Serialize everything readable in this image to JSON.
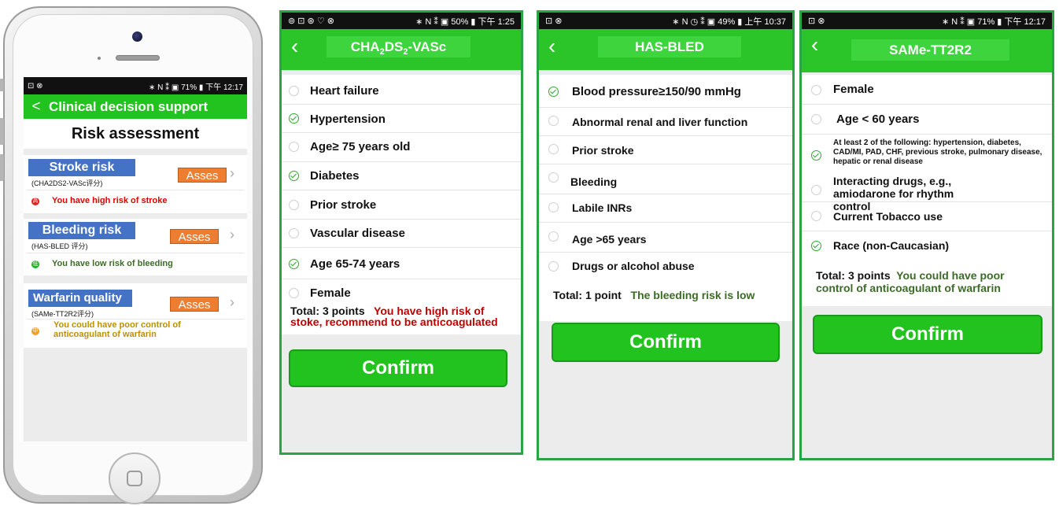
{
  "colors": {
    "green": "#22c31f",
    "blue": "#4472c4",
    "orange": "#ed7d31",
    "red": "#c00000",
    "dark_green": "#3c6b28",
    "gold": "#bf8f00"
  },
  "phone": {
    "status": {
      "left": "⊡ ⊗",
      "right": "∗ N ⁑ ▣ 71% ▮ 下午 12:17"
    },
    "header": {
      "back": "<",
      "title": "Clinical decision support"
    },
    "page_title": "Risk assessment",
    "asses_label": "Asses",
    "cards": [
      {
        "title": "Stroke risk",
        "subtitle": "(CHA2DS2-VASc评分)",
        "result": "You have high risk of stroke",
        "dot": "高"
      },
      {
        "title": "Bleeding risk",
        "subtitle": "(HAS-BLED 评分)",
        "result": "You have low  risk of bleeding",
        "dot": "低"
      },
      {
        "title": "Warfarin quality",
        "subtitle": "(SAMe-TT2R2评分)",
        "result": "You could have poor control of anticoagulant of warfarin",
        "dot": "中"
      }
    ]
  },
  "screens": [
    {
      "status": {
        "left": "⊚ ⊡ ⊛ ♡ ⊗",
        "right": "∗ N ⁑ ▣ 50% ▮ 下午 1:25"
      },
      "title_main": "CHA",
      "title_sub1": "2",
      "title_mid": "DS",
      "title_sub2": "2",
      "title_end": "-VASc",
      "items": [
        {
          "label": "Heart failure",
          "checked": false
        },
        {
          "label": "Hypertension",
          "checked": true
        },
        {
          "label": "Age≥ 75 years old",
          "checked": false
        },
        {
          "label": "Diabetes",
          "checked": true
        },
        {
          "label": "Prior stroke",
          "checked": false
        },
        {
          "label": "Vascular disease",
          "checked": false
        },
        {
          "label": "Age 65-74 years",
          "checked": true
        },
        {
          "label": "Female",
          "checked": false
        }
      ],
      "total_label": "Total: 3 points",
      "result": "You have high risk of stoke, recommend to be anticoagulated",
      "confirm": "Confirm"
    },
    {
      "status": {
        "left": "⊡ ⊗",
        "right": "∗ N ◷ ⁑ ▣ 49% ▮ 上午 10:37"
      },
      "title": "HAS-BLED",
      "items": [
        {
          "label": "Blood pressure≥150/90 mmHg",
          "checked": true
        },
        {
          "label": "Abnormal renal and liver function",
          "checked": false
        },
        {
          "label": "Prior stroke",
          "checked": false
        },
        {
          "label": "Bleeding",
          "checked": false
        },
        {
          "label": "Labile INRs",
          "checked": false
        },
        {
          "label": "Age >65 years",
          "checked": false
        },
        {
          "label": "Drugs or alcohol abuse",
          "checked": false
        }
      ],
      "total_label": "Total: 1 point",
      "result": "The bleeding risk is low",
      "confirm": "Confirm"
    },
    {
      "status": {
        "left": "⊡ ⊗",
        "right": "∗ N ⁑ ▣ 71% ▮ 下午 12:17"
      },
      "title": "SAMe-TT2R2",
      "items": [
        {
          "label": "Female",
          "checked": false
        },
        {
          "label": "Age < 60 years",
          "checked": false
        },
        {
          "label": "At least 2 of the following: hypertension, diabetes, CAD/MI, PAD, CHF, previous stroke, pulmonary disease, hepatic or renal disease",
          "checked": true
        },
        {
          "label": "Interacting drugs, e.g., amiodarone for rhythm control",
          "checked": false
        },
        {
          "label": "Current Tobacco use",
          "checked": false
        },
        {
          "label": "Race (non-Caucasian)",
          "checked": true
        }
      ],
      "total_label": "Total: 3 points",
      "result": "You could have poor control of anticoagulant of warfarin",
      "confirm": "Confirm"
    }
  ]
}
